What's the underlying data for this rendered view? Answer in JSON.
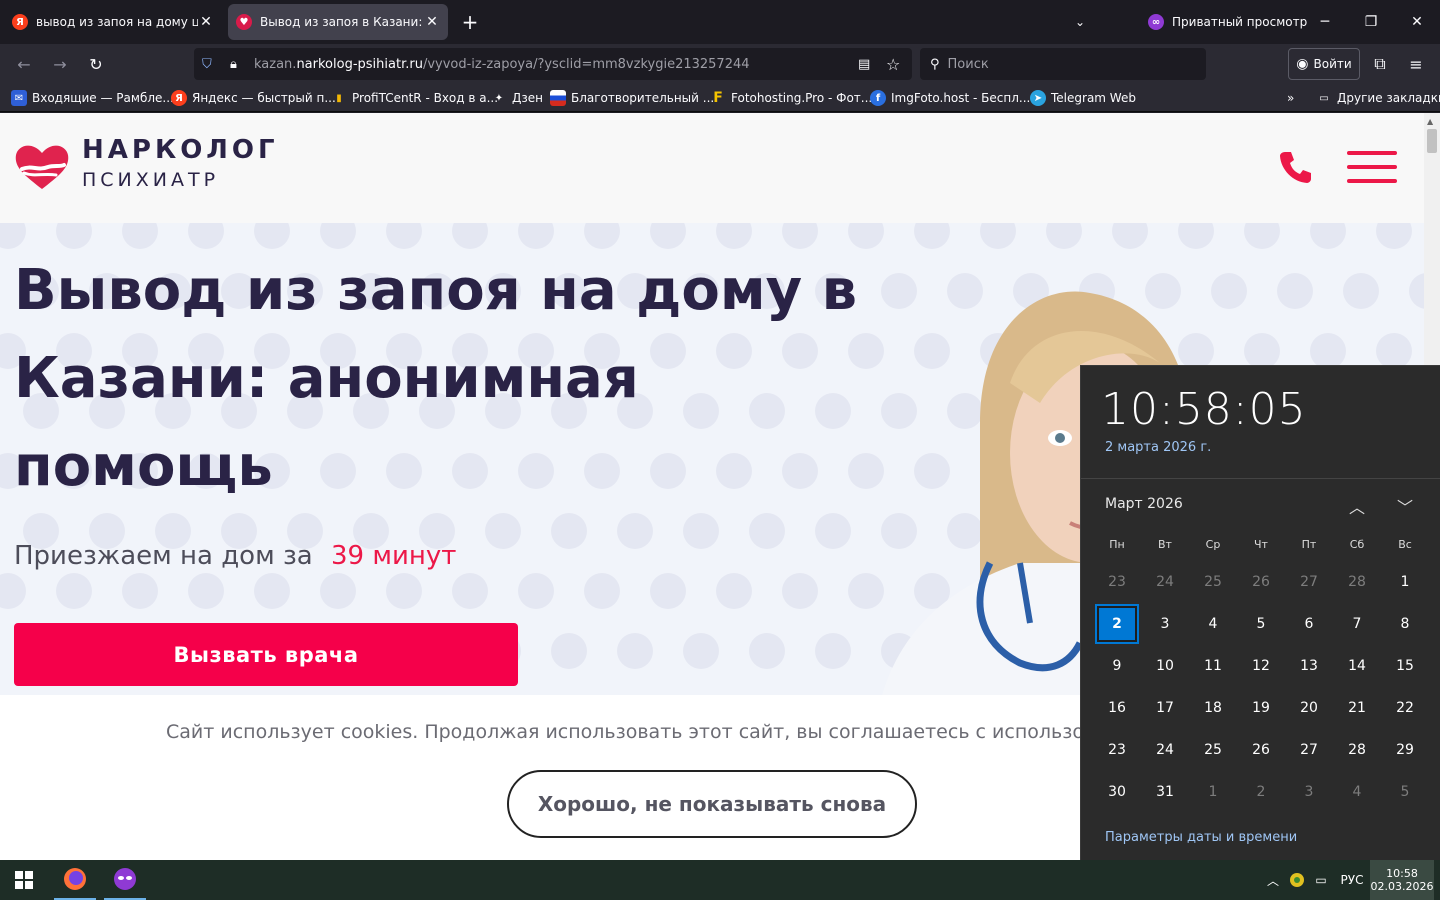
{
  "browser": {
    "tabs": [
      {
        "title": "вывод из запоя на дому цена",
        "favicon": "yandex-icon",
        "active": false
      },
      {
        "title": "Вывод из запоя в Казани: пом",
        "favicon": "narkolog-heart-icon",
        "active": true
      }
    ],
    "new_tab_label": "+",
    "private_label": "Приватный просмотр",
    "url_host": "kazan.",
    "url_domain": "narkolog-psihiatr.ru",
    "url_path": "/vyvod-iz-zapoya/?ysclid=mm8vzkygie213257244",
    "search_placeholder": "Поиск",
    "login_label": "Войти",
    "bookmarks": [
      {
        "label": "Входящие — Рамбле...",
        "icon": "mail-icon"
      },
      {
        "label": "Яндекс — быстрый п...",
        "icon": "yandex-icon"
      },
      {
        "label": "ProfiTCentR - Вход в а...",
        "icon": "chart-icon"
      },
      {
        "label": "Дзен",
        "icon": "zen-icon"
      },
      {
        "label": "Благотворительный ...",
        "icon": "flag-icon"
      },
      {
        "label": "Fotohosting.Pro - Фот...",
        "icon": "f-icon"
      },
      {
        "label": "ImgFoto.host - Беспл...",
        "icon": "imgfoto-icon"
      },
      {
        "label": "Telegram Web",
        "icon": "telegram-icon"
      }
    ],
    "other_bookmarks": "Другие закладки"
  },
  "site": {
    "logo_line1": "НАРКОЛОГ",
    "logo_line2": "ПСИХИАТР",
    "headline": "Вывод из запоя на дому в Казани: анонимная помощь",
    "subline": "Приезжаем на дом за",
    "subline_highlight": "39 минут",
    "cta_label": "Вызвать врача",
    "cookie_text": "Сайт использует cookies. Продолжая использовать этот сайт, вы соглашаетесь с использовани",
    "cookie_button": "Хорошо, не показывать снова",
    "accent_color": "#f5004a",
    "heading_color": "#2a2346"
  },
  "calendar": {
    "time": "10:58:05",
    "date": "2 марта 2026 г.",
    "month": "Март 2026",
    "weekdays": [
      "Пн",
      "Вт",
      "Ср",
      "Чт",
      "Пт",
      "Сб",
      "Вс"
    ],
    "weeks": [
      [
        "23",
        "24",
        "25",
        "26",
        "27",
        "28",
        "1"
      ],
      [
        "2",
        "3",
        "4",
        "5",
        "6",
        "7",
        "8"
      ],
      [
        "9",
        "10",
        "11",
        "12",
        "13",
        "14",
        "15"
      ],
      [
        "16",
        "17",
        "18",
        "19",
        "20",
        "21",
        "22"
      ],
      [
        "23",
        "24",
        "25",
        "26",
        "27",
        "28",
        "29"
      ],
      [
        "30",
        "31",
        "1",
        "2",
        "3",
        "4",
        "5"
      ]
    ],
    "today": "2",
    "settings_link": "Параметры даты и времени"
  },
  "taskbar": {
    "language": "РУС",
    "time": "10:58",
    "date": "02.03.2026"
  }
}
